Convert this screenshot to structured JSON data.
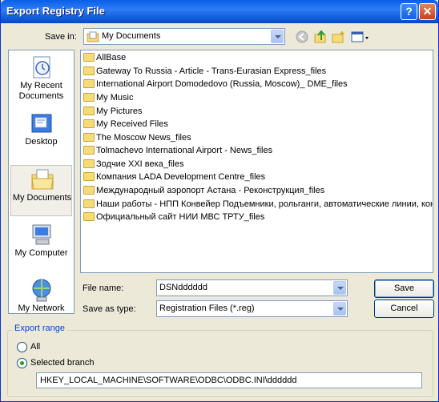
{
  "window": {
    "title": "Export Registry File"
  },
  "titlebar": {
    "help_label": "?",
    "close_label": "✕"
  },
  "save_in": {
    "label": "Save in:",
    "value": "My Documents"
  },
  "places": [
    {
      "label": "My Recent Documents",
      "icon": "recent-documents-icon"
    },
    {
      "label": "Desktop",
      "icon": "desktop-icon"
    },
    {
      "label": "My Documents",
      "icon": "my-documents-icon"
    },
    {
      "label": "My Computer",
      "icon": "my-computer-icon"
    },
    {
      "label": "My Network",
      "icon": "my-network-icon"
    }
  ],
  "files": [
    "AllBase",
    "Gateway To Russia - Article - Trans-Eurasian Express_files",
    "International Airport Domodedovo (Russia, Moscow)_ DME_files",
    "My Music",
    "My Pictures",
    "My Received Files",
    "The Moscow News_files",
    "Tolmachevo International Airport - News_files",
    "Зодчие XXI века_files",
    "Компания LADA Development Centre_files",
    "Международный аэропорт Астана - Реконструкция_files",
    "Наши работы - НПП Конвейер  Подъемники, рольганги, автоматические линии, конв",
    "Официальный сайт НИИ МВС ТРТУ_files"
  ],
  "file_name": {
    "label": "File name:",
    "value": "DSNdddddd"
  },
  "save_as_type": {
    "label": "Save as type:",
    "value": "Registration Files (*.reg)"
  },
  "buttons": {
    "save": "Save",
    "cancel": "Cancel"
  },
  "export_range": {
    "label": "Export range",
    "all_label": "All",
    "selected_label": "Selected branch",
    "branch_value": "HKEY_LOCAL_MACHINE\\SOFTWARE\\ODBC\\ODBC.INI\\dddddd"
  }
}
